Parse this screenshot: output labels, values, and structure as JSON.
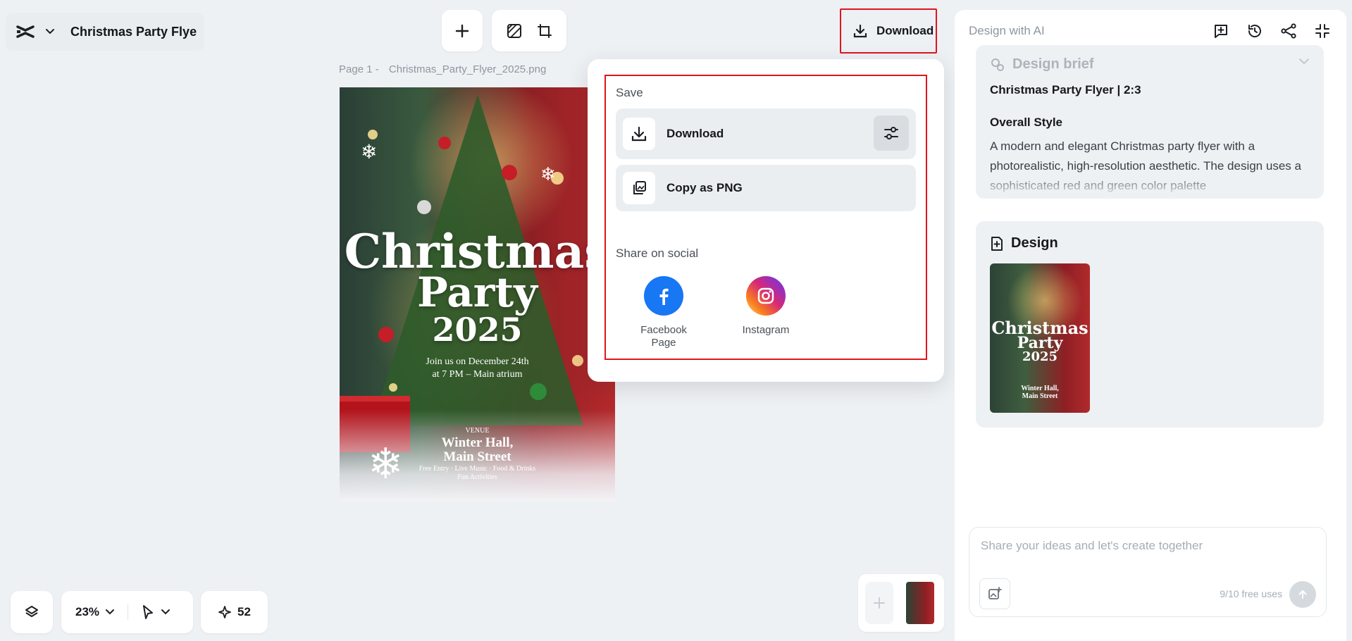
{
  "project": {
    "title": "Christmas Party Flye"
  },
  "header": {
    "download_label": "Download"
  },
  "canvas": {
    "page_label": "Page 1 -",
    "file_name": "Christmas_Party_Flyer_2025.png"
  },
  "flyer": {
    "title_line1": "Christmas",
    "title_line2": "Party",
    "year": "2025",
    "invite": "Join us on December 24th",
    "time": "at 7 PM – Main atrium",
    "venue_small": "VENUE",
    "venue_line1": "Winter Hall,",
    "venue_line2": "Main Street",
    "perks_line1": "Free Entry · Live Music · Food & Drinks",
    "perks_line2": "Fun Activities"
  },
  "download_menu": {
    "save_title": "Save",
    "download_label": "Download",
    "copy_label": "Copy as PNG",
    "share_title": "Share on social",
    "social": [
      {
        "name": "facebook-page",
        "label_line1": "Facebook",
        "label_line2": "Page",
        "color": "#1877f2"
      },
      {
        "name": "instagram",
        "label_line1": "Instagram",
        "label_line2": "",
        "color": "#e1306c"
      }
    ]
  },
  "ai_panel": {
    "title": "Design with AI",
    "brief_title": "Design brief",
    "brief_heading": "Christmas Party Flyer | 2:3",
    "overall_style_title": "Overall Style",
    "overall_style_text": "A modern and elegant Christmas party flyer with a photorealistic, high-resolution aesthetic. The design uses a sophisticated red and green color palette",
    "design_title": "Design",
    "thumb_line1": "Christmas",
    "thumb_line2": "Party",
    "thumb_year": "2025",
    "thumb_venue1": "Winter Hall,",
    "thumb_venue2": "Main Street",
    "chat_placeholder": "Share your ideas and let's create together",
    "free_uses": "9/10 free uses"
  },
  "bottom_bar": {
    "zoom": "23%",
    "credits": "52"
  },
  "colors": {
    "accent_red": "#e0141e",
    "panel_bg": "#eef1f4"
  }
}
